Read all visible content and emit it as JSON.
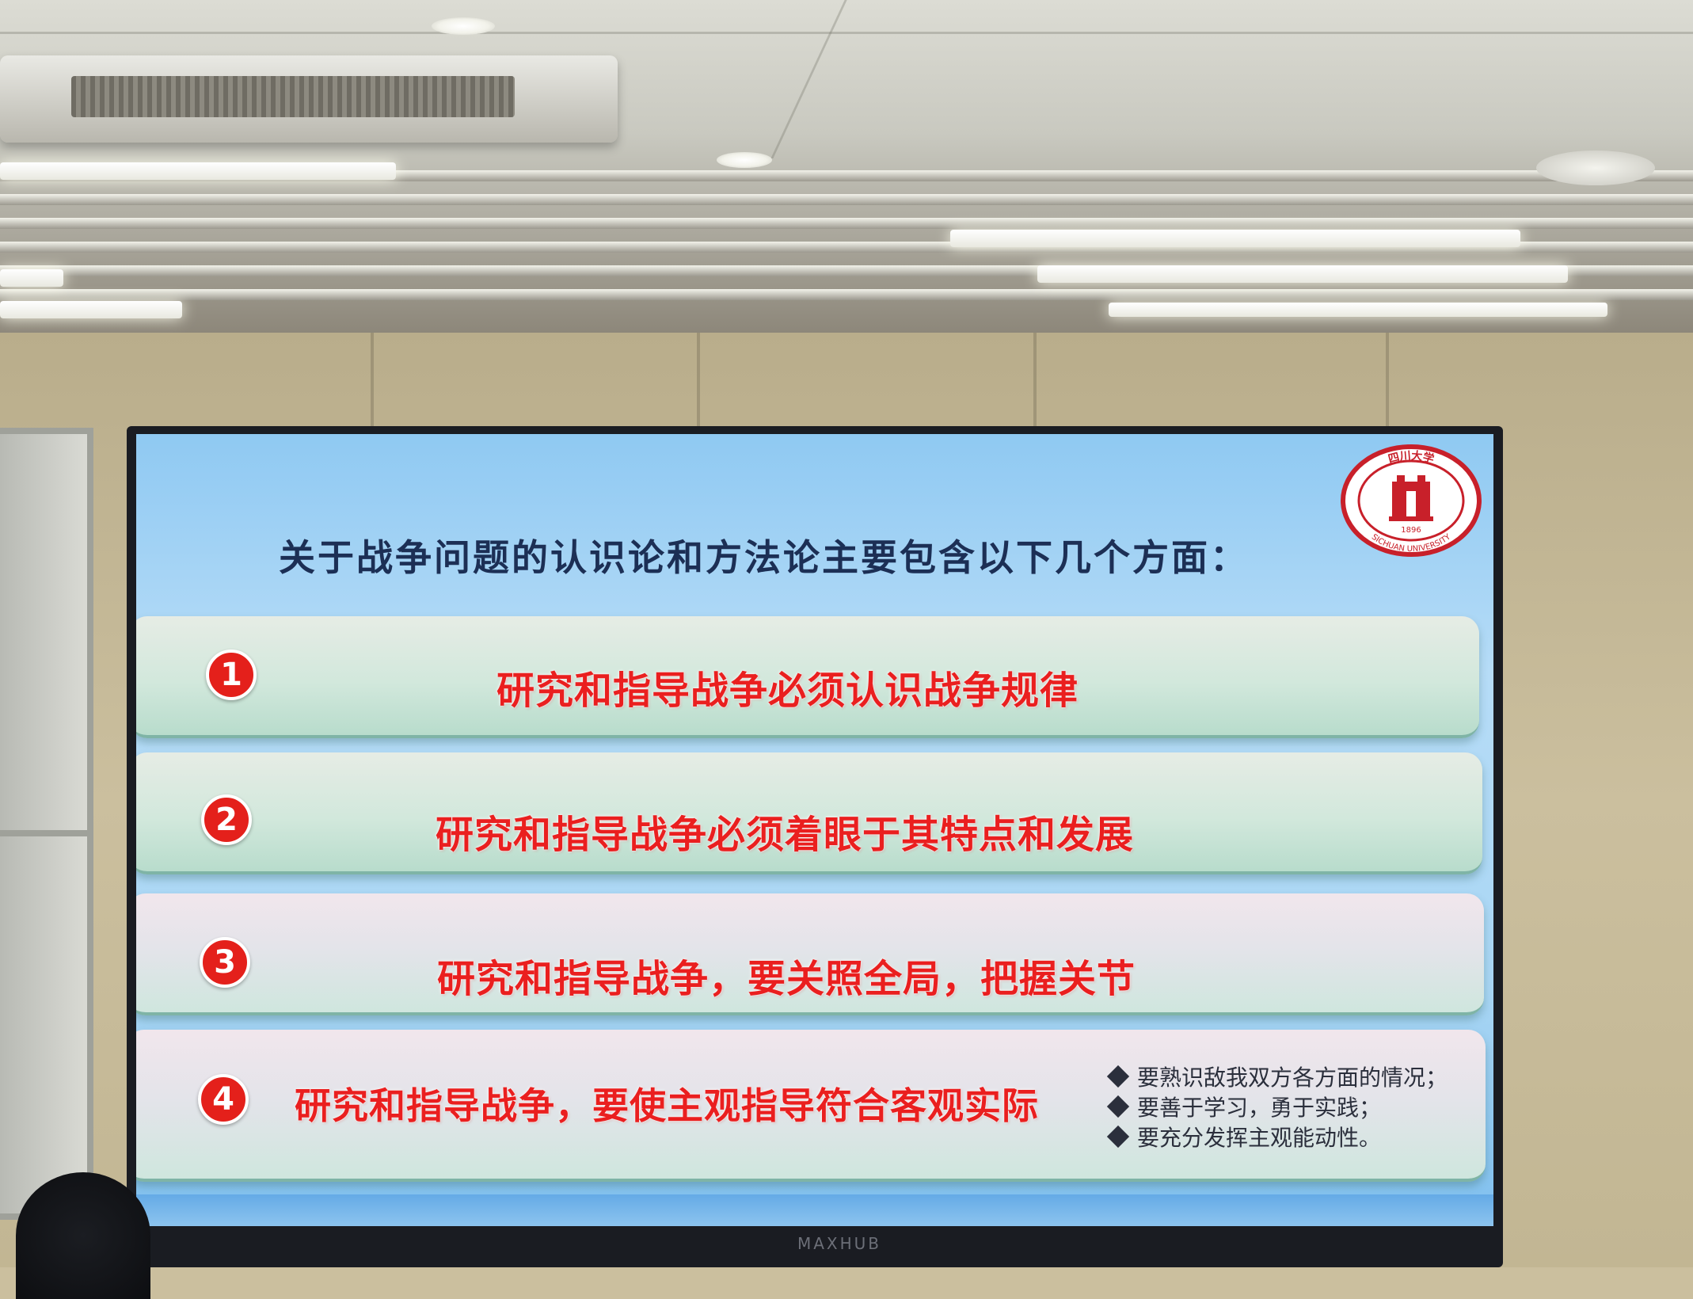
{
  "slide": {
    "title": "关于战争问题的认识论和方法论主要包含以下几个方面：",
    "points": [
      {
        "number": "1",
        "text": "研究和指导战争必须认识战争规律"
      },
      {
        "number": "2",
        "text": "研究和指导战争必须着眼于其特点和发展"
      },
      {
        "number": "3",
        "text": "研究和指导战争，要关照全局，把握关节"
      },
      {
        "number": "4",
        "text": "研究和指导战争，要使主观指导符合客观实际"
      }
    ],
    "subpoints": [
      "要熟识敌我双方各方面的情况；",
      "要善于学习，勇于实践；",
      "要充分发挥主观能动性。"
    ],
    "logo": {
      "name": "university-seal",
      "year": "1896",
      "english": "SICHUAN UNIVERSITY",
      "chinese": "四川大学",
      "color": "#c8202a"
    }
  },
  "display": {
    "brand": "MAXHUB"
  },
  "colors": {
    "slide_background": "#a9d6f4",
    "title_color": "#1c2f55",
    "point_text_color": "#ea1f1f",
    "number_badge_color": "#e4201b",
    "subpoint_color": "#2b2f3c"
  },
  "icons": {
    "bullet": "diamond-bullet-icon",
    "number_badge": "number-circle-icon"
  }
}
